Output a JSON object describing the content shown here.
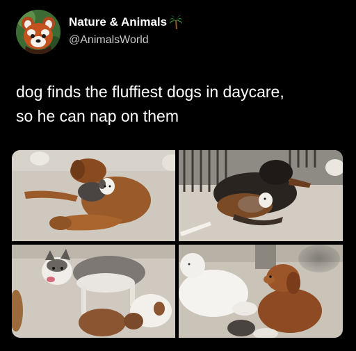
{
  "post": {
    "author": {
      "display_name": "Nature & Animals",
      "handle": "@AnimalsWorld",
      "avatar": "red-panda-avatar",
      "badge_icon": "palm-tree-icon"
    },
    "text_line_1": "dog finds the fluffiest dogs in daycare,",
    "text_line_2": "so he can nap on them",
    "photos": [
      {
        "subject": "dog-lying-on-golden-dog-photo"
      },
      {
        "subject": "dog-lying-on-black-tan-dog-photo"
      },
      {
        "subject": "husky-and-dogs-photo"
      },
      {
        "subject": "poodle-and-setter-photo"
      }
    ]
  },
  "colors": {
    "background": "#000000",
    "text": "#ffffff",
    "handle": "#c9c9c9",
    "floor": "#cbc5bb"
  }
}
